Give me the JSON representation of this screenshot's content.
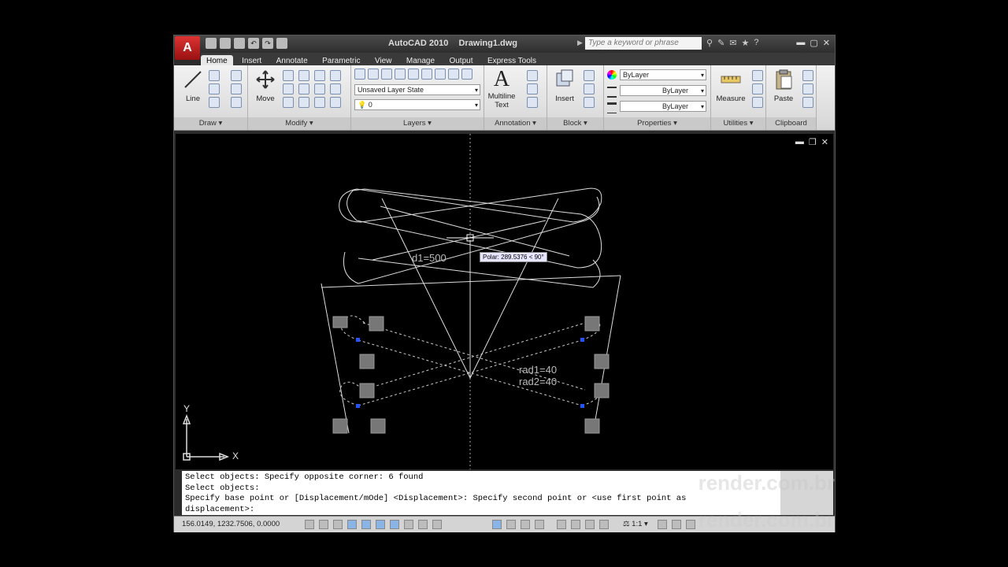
{
  "app": {
    "title": "AutoCAD 2010",
    "file": "Drawing1.dwg",
    "logo": "A"
  },
  "search": {
    "placeholder": "Type a keyword or phrase"
  },
  "tabs": [
    "Home",
    "Insert",
    "Annotate",
    "Parametric",
    "View",
    "Manage",
    "Output",
    "Express Tools"
  ],
  "ribbon": {
    "draw": {
      "label": "Draw",
      "line_label": "Line"
    },
    "modify": {
      "label": "Modify",
      "move_label": "Move"
    },
    "layers": {
      "label": "Layers",
      "layer_state": "Unsaved Layer State",
      "layer_value": "0"
    },
    "annotation": {
      "label": "Annotation",
      "text_label_1": "Multiline",
      "text_label_2": "Text",
      "text_icon": "A"
    },
    "block": {
      "label": "Block",
      "insert_label": "Insert"
    },
    "properties": {
      "label": "Properties",
      "color": "ByLayer",
      "linetype": "ByLayer",
      "lineweight": "ByLayer"
    },
    "utilities": {
      "label": "Utilities",
      "measure_label": "Measure"
    },
    "clipboard": {
      "label": "Clipboard",
      "paste_label": "Paste"
    }
  },
  "viewport": {
    "tooltip": "Polar: 289.5376 < 90°",
    "dim_d1": "d1=500",
    "dim_rad1": "rad1=40",
    "dim_rad2": "rad2=40",
    "axis_x": "X",
    "axis_y": "Y"
  },
  "command": {
    "lines": [
      "Select objects: Specify opposite corner: 6 found",
      "Select objects:",
      "Specify base point or [Displacement/mOde] <Displacement>: Specify second point or <use first point as",
      "displacement>:"
    ]
  },
  "status": {
    "coords": "156.0149, 1232.7506, 0.0000",
    "scale": "1:1"
  },
  "watermark": {
    "text": "render.com.br"
  },
  "colors": {
    "accent": "#cc2222",
    "tooltip_bg": "#e6e6ff",
    "grip": "#2255ff"
  }
}
